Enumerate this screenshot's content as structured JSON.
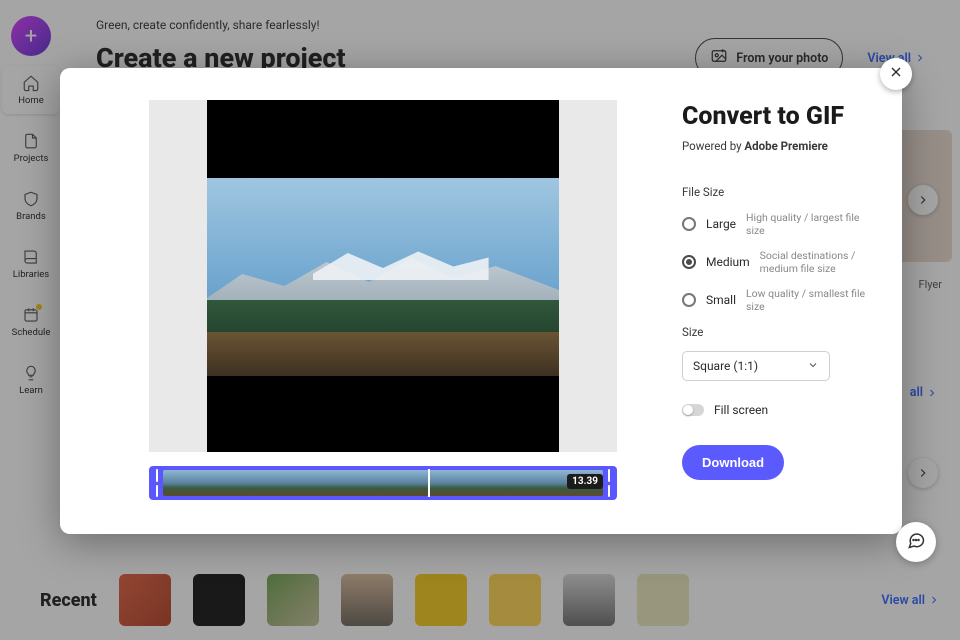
{
  "background": {
    "greeting": "Green, create confidently, share fearlessly!",
    "heading": "Create a new project",
    "from_photo": "From your photo",
    "view_all": "View all",
    "nav": [
      {
        "label": "Home"
      },
      {
        "label": "Projects"
      },
      {
        "label": "Brands"
      },
      {
        "label": "Libraries"
      },
      {
        "label": "Schedule"
      },
      {
        "label": "Learn"
      }
    ],
    "peek_label": "Flyer",
    "mid_link": "all",
    "recent": {
      "title": "Recent",
      "view_all": "View all"
    }
  },
  "modal": {
    "title": "Convert to GIF",
    "powered_prefix": "Powered by ",
    "powered_brand": "Adobe Premiere",
    "file_size_label": "File Size",
    "options": [
      {
        "name": "Large",
        "desc": "High quality / largest file size",
        "selected": false
      },
      {
        "name": "Medium",
        "desc": "Social destinations / medium file size",
        "selected": true
      },
      {
        "name": "Small",
        "desc": "Low quality / smallest file size",
        "selected": false
      }
    ],
    "size_label": "Size",
    "size_value": "Square (1:1)",
    "fill_screen": "Fill screen",
    "download": "Download",
    "timeline": {
      "duration_label": "13.39"
    }
  }
}
